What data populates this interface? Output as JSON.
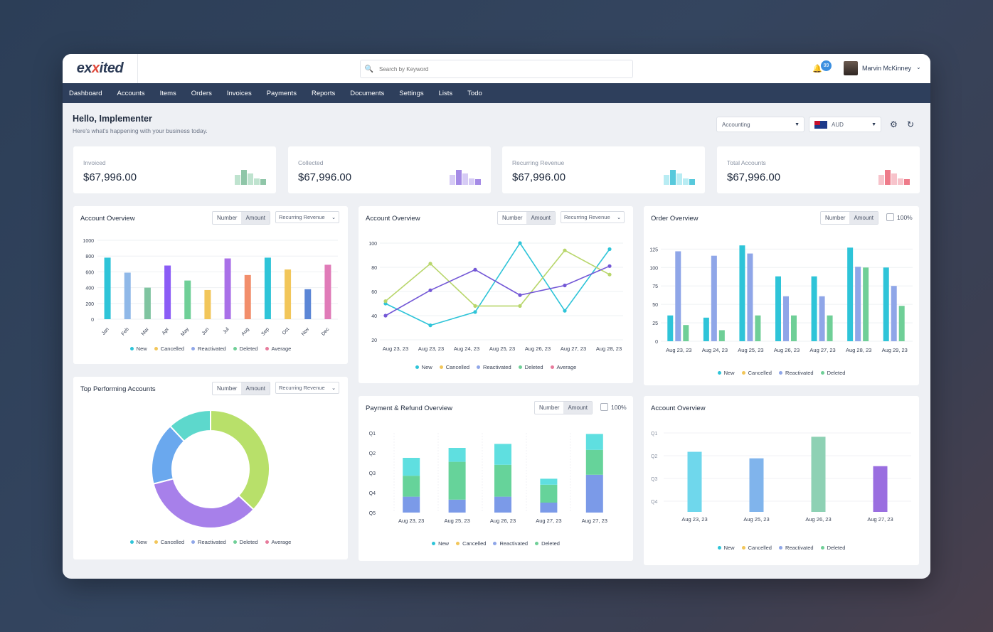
{
  "app": {
    "logo_pre": "ex",
    "logo_x": "x",
    "logo_post": "ited"
  },
  "search": {
    "placeholder": "Search by Keyword"
  },
  "user": {
    "notifications": "99",
    "name": "Marvin McKinney"
  },
  "nav": [
    "Dashboard",
    "Accounts",
    "Items",
    "Orders",
    "Invoices",
    "Payments",
    "Reports",
    "Documents",
    "Settings",
    "Lists",
    "Todo"
  ],
  "header": {
    "title": "Hello, Implementer",
    "subtitle": "Here's what's happening with your business today."
  },
  "filters": {
    "module": "Accounting",
    "currency": "AUD"
  },
  "kpis": [
    {
      "label": "Invoiced",
      "value": "$67,996.00",
      "colors": [
        "#8fc6a8",
        "#bfe3cf"
      ]
    },
    {
      "label": "Collected",
      "value": "$67,996.00",
      "colors": [
        "#a58be6",
        "#d6cbf5"
      ]
    },
    {
      "label": "Recurring Revenue",
      "value": "$67,996.00",
      "colors": [
        "#57c9dc",
        "#b8ecf3"
      ]
    },
    {
      "label": "Total Accounts",
      "value": "$67,996.00",
      "colors": [
        "#ee7b8a",
        "#f7c3cb"
      ]
    }
  ],
  "toggle": {
    "number": "Number",
    "amount": "Amount",
    "revenue": "Recurring Revenue",
    "pct": "100%"
  },
  "cards": {
    "c1": "Account Overview",
    "c2": "Account Overview",
    "c3": "Order Overview",
    "c4": "Top Performing Accounts",
    "c5": "Payment & Refund Overview",
    "c6": "Account Overview"
  },
  "legend_labels": {
    "new": "New",
    "cancelled": "Cancelled",
    "reactivated": "Reactivated",
    "deleted": "Deleted",
    "average": "Average"
  },
  "colors": {
    "new": "#2ec4d8",
    "cancelled": "#f2c65a",
    "reactivated": "#8fa6e8",
    "deleted": "#6fcf97",
    "average": "#e77b9c",
    "purple": "#8b5cf6"
  },
  "chart_data": [
    {
      "type": "bar",
      "title": "Account Overview",
      "categories": [
        "Jan",
        "Feb",
        "Mar",
        "Apr",
        "May",
        "Jun",
        "Jul",
        "Aug",
        "Sep",
        "Oct",
        "Nov",
        "Dec"
      ],
      "values": [
        780,
        590,
        400,
        680,
        490,
        370,
        770,
        560,
        780,
        630,
        380,
        690
      ],
      "y_ticks": [
        0,
        200,
        400,
        600,
        800,
        1000
      ],
      "ylim": [
        0,
        1000
      ],
      "bar_colors": [
        "#2ec4d8",
        "#8fb8e8",
        "#7fc4a0",
        "#8b5cf6",
        "#6fcf97",
        "#f2c65a",
        "#a970e8",
        "#f28e6b",
        "#2ec4d8",
        "#f2c65a",
        "#5b86d6",
        "#e07bb8"
      ]
    },
    {
      "type": "line",
      "title": "Account Overview",
      "categories": [
        "Aug 23, 23",
        "Aug 23, 23",
        "Aug 24, 23",
        "Aug 25, 23",
        "Aug 26, 23",
        "Aug 27, 23",
        "Aug 28, 23"
      ],
      "y_ticks": [
        20,
        40,
        60,
        80,
        100
      ],
      "ylim": [
        20,
        100
      ],
      "series": [
        {
          "name": "New",
          "color": "#2ec4d8",
          "values": [
            50,
            32,
            43,
            100,
            44,
            95
          ]
        },
        {
          "name": "Cancelled",
          "color": "#b8d66b",
          "values": [
            52,
            83,
            48,
            48,
            94,
            74
          ]
        },
        {
          "name": "Reactivated",
          "color": "#7357d6",
          "values": [
            40,
            61,
            78,
            57,
            65,
            81
          ]
        }
      ]
    },
    {
      "type": "bar",
      "title": "Order Overview",
      "categories": [
        "Aug 23, 23",
        "Aug 24, 23",
        "Aug 25, 23",
        "Aug 26, 23",
        "Aug 27, 23",
        "Aug 28, 23",
        "Aug 29, 23"
      ],
      "y_ticks": [
        0,
        25,
        50,
        75,
        100,
        125
      ],
      "ylim": [
        0,
        135
      ],
      "series": [
        {
          "name": "New",
          "color": "#2ec4d8",
          "values": [
            35,
            32,
            130,
            88,
            88,
            127,
            100
          ]
        },
        {
          "name": "Reactivated",
          "color": "#8fa6e8",
          "values": [
            122,
            116,
            119,
            61,
            61,
            101,
            75
          ]
        },
        {
          "name": "Deleted",
          "color": "#6fcf97",
          "values": [
            22,
            15,
            35,
            35,
            35,
            100,
            48
          ]
        }
      ]
    },
    {
      "type": "pie",
      "title": "Top Performing Accounts",
      "slices": [
        {
          "label": "Cancelled",
          "value": 37,
          "color": "#b8e06a"
        },
        {
          "label": "Reactivated",
          "value": 34,
          "color": "#a780ea"
        },
        {
          "label": "New",
          "value": 17,
          "color": "#6aa8ee"
        },
        {
          "label": "Deleted",
          "value": 12,
          "color": "#5dd8cc"
        }
      ]
    },
    {
      "type": "bar",
      "title": "Payment & Refund Overview",
      "stacked": true,
      "categories": [
        "Aug 23, 23",
        "Aug 25, 23",
        "Aug 26, 23",
        "Aug 27, 23",
        "Aug 27, 23"
      ],
      "y_ticks": [
        "Q1",
        "Q2",
        "Q3",
        "Q4",
        "Q5"
      ],
      "series": [
        {
          "name": "Reactivated",
          "color": "#7b9ae8",
          "values": [
            0.8,
            0.65,
            0.8,
            0.5,
            1.9
          ]
        },
        {
          "name": "Deleted",
          "color": "#66d39a",
          "values": [
            1.05,
            1.9,
            1.6,
            0.9,
            1.25
          ]
        },
        {
          "name": "New",
          "color": "#5fdfe0",
          "values": [
            0.9,
            0.7,
            1.05,
            0.3,
            0.8
          ]
        }
      ]
    },
    {
      "type": "bar",
      "title": "Account Overview",
      "categories": [
        "Aug 23, 23",
        "Aug 25, 23",
        "Aug 26, 23",
        "Aug 27, 23"
      ],
      "y_ticks": [
        "Q1",
        "Q2",
        "Q3",
        "Q4"
      ],
      "values": [
        0.92,
        0.82,
        1.15,
        0.7
      ],
      "bar_colors": [
        "#6fd7ec",
        "#80b4ec",
        "#8ed1b4",
        "#9a6ee0"
      ]
    }
  ]
}
